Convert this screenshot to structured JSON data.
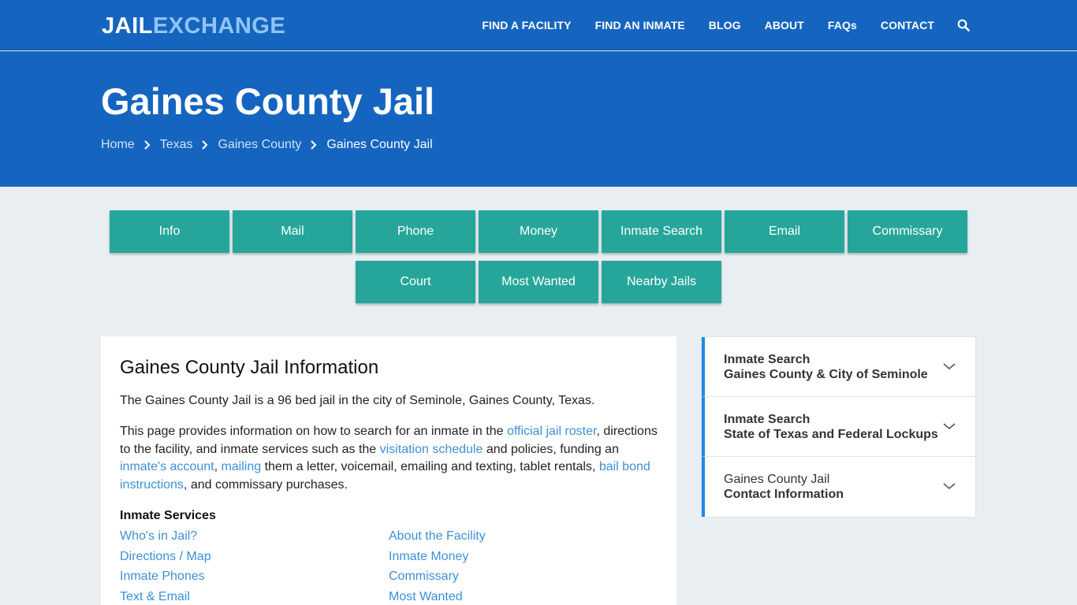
{
  "header": {
    "logo_part1": "JAIL",
    "logo_part2": "EXCHANGE",
    "nav": [
      "FIND A FACILITY",
      "FIND AN INMATE",
      "BLOG",
      "ABOUT",
      "FAQs",
      "CONTACT"
    ],
    "search_icon": "search-icon"
  },
  "hero": {
    "title": "Gaines County Jail",
    "breadcrumb": [
      "Home",
      "Texas",
      "Gaines County",
      "Gaines County Jail"
    ]
  },
  "tabs": {
    "row1": [
      "Info",
      "Mail",
      "Phone",
      "Money",
      "Inmate Search",
      "Email",
      "Commissary"
    ],
    "row2": [
      "Court",
      "Most Wanted",
      "Nearby Jails"
    ]
  },
  "main": {
    "heading": "Gaines County Jail Information",
    "intro": "The Gaines County Jail is a 96 bed jail in the city of Seminole, Gaines County, Texas.",
    "para": {
      "t1": "This page provides information on how to search for an inmate in the ",
      "l1": "official jail roster",
      "t2": ", directions to the facility, and inmate services such as the ",
      "l2": "visitation schedule",
      "t3": " and policies, funding an ",
      "l3": "inmate's account",
      "t4": ", ",
      "l4": "mailing",
      "t5": " them a letter, voicemail, emailing and texting, tablet rentals, ",
      "l5": "bail bond instructions",
      "t6": ", and commissary purchases."
    },
    "services_title": "Inmate Services",
    "services": [
      "Who's in Jail?",
      "About the Facility",
      "Directions / Map",
      "Inmate Money",
      "Inmate Phones",
      "Commissary",
      "Text & Email",
      "Most Wanted"
    ]
  },
  "sidebar": [
    {
      "line1": "Inmate Search",
      "line2": "Gaines County & City of Seminole",
      "line1_bold": true
    },
    {
      "line1": "Inmate Search",
      "line2": "State of Texas and Federal Lockups",
      "line1_bold": true
    },
    {
      "line1": "Gaines County Jail",
      "line2": "Contact Information",
      "line1_bold": false
    }
  ],
  "colors": {
    "brand": "#1565c0",
    "tab": "#26a69a",
    "link": "#3d8fd9",
    "accent": "#1e88e5"
  }
}
